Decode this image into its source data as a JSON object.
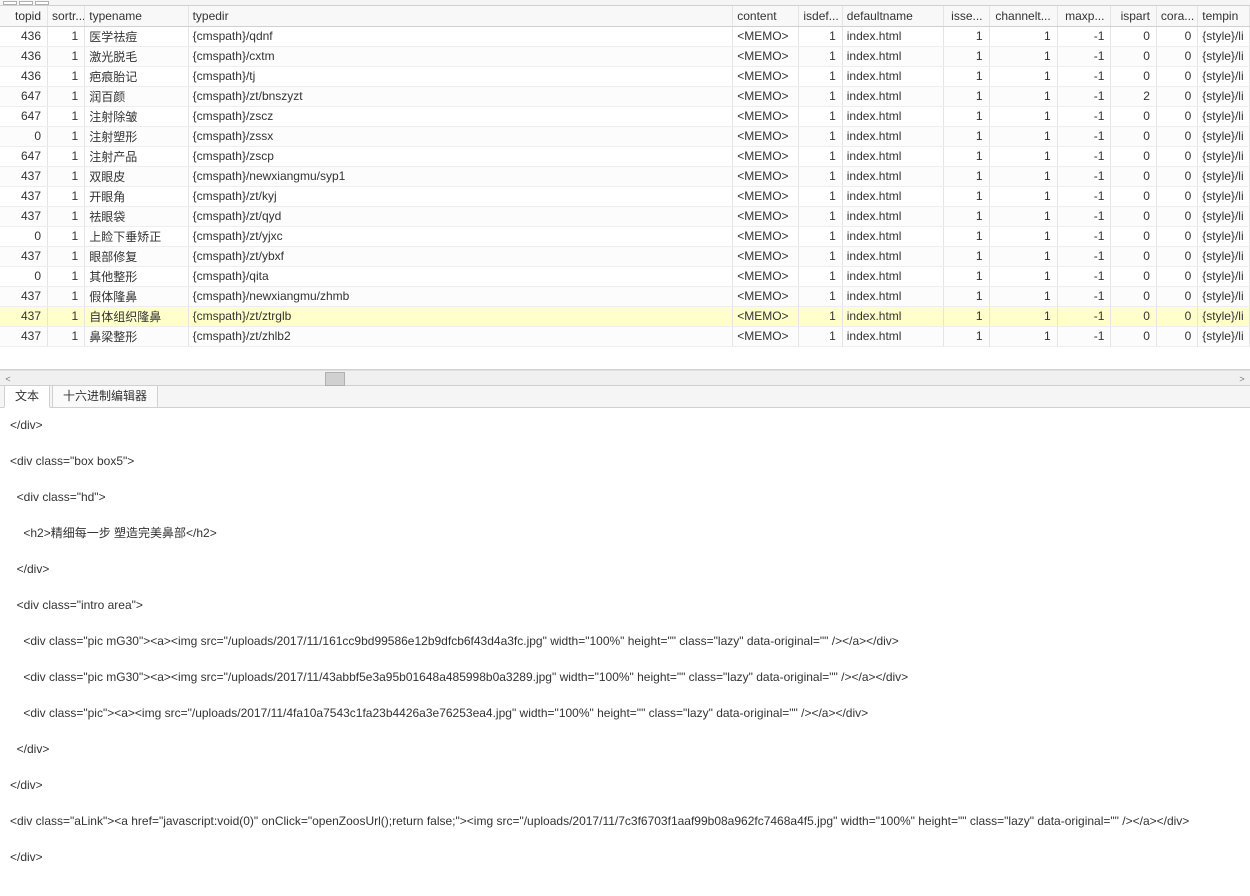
{
  "columns": [
    {
      "key": "topid",
      "label": "topid",
      "cls": "c-topid num"
    },
    {
      "key": "sortr",
      "label": "sortr...",
      "cls": "c-sortr num"
    },
    {
      "key": "typename",
      "label": "typename",
      "cls": "c-typename"
    },
    {
      "key": "typedir",
      "label": "typedir",
      "cls": "c-typedir"
    },
    {
      "key": "content",
      "label": "content",
      "cls": "c-content"
    },
    {
      "key": "isdef",
      "label": "isdef...",
      "cls": "c-isdef num"
    },
    {
      "key": "defaultname",
      "label": "defaultname",
      "cls": "c-defaultname"
    },
    {
      "key": "isse",
      "label": "isse...",
      "cls": "c-isse num"
    },
    {
      "key": "channelt",
      "label": "channelt...",
      "cls": "c-channelt num"
    },
    {
      "key": "maxp",
      "label": "maxp...",
      "cls": "c-maxp num"
    },
    {
      "key": "ispart",
      "label": "ispart",
      "cls": "c-ispart num"
    },
    {
      "key": "cora",
      "label": "cora...",
      "cls": "c-cora num"
    },
    {
      "key": "tempin",
      "label": "tempin",
      "cls": "c-tempin"
    }
  ],
  "rows": [
    {
      "topid": 436,
      "sortr": 1,
      "typename": "医学祛痘",
      "typedir": "{cmspath}/qdnf",
      "content": "<MEMO>",
      "isdef": 1,
      "defaultname": "index.html",
      "isse": 1,
      "channelt": 1,
      "maxp": -1,
      "ispart": 0,
      "cora": 0,
      "tempin": "{style}/li"
    },
    {
      "topid": 436,
      "sortr": 1,
      "typename": "激光脱毛",
      "typedir": "{cmspath}/cxtm",
      "content": "<MEMO>",
      "isdef": 1,
      "defaultname": "index.html",
      "isse": 1,
      "channelt": 1,
      "maxp": -1,
      "ispart": 0,
      "cora": 0,
      "tempin": "{style}/li"
    },
    {
      "topid": 436,
      "sortr": 1,
      "typename": "疤痕胎记",
      "typedir": "{cmspath}/tj",
      "content": "<MEMO>",
      "isdef": 1,
      "defaultname": "index.html",
      "isse": 1,
      "channelt": 1,
      "maxp": -1,
      "ispart": 0,
      "cora": 0,
      "tempin": "{style}/li"
    },
    {
      "topid": 647,
      "sortr": 1,
      "typename": "润百颜",
      "typedir": "{cmspath}/zt/bnszyzt",
      "content": "<MEMO>",
      "isdef": 1,
      "defaultname": "index.html",
      "isse": 1,
      "channelt": 1,
      "maxp": -1,
      "ispart": 2,
      "cora": 0,
      "tempin": "{style}/li"
    },
    {
      "topid": 647,
      "sortr": 1,
      "typename": "注射除皱",
      "typedir": "{cmspath}/zscz",
      "content": "<MEMO>",
      "isdef": 1,
      "defaultname": "index.html",
      "isse": 1,
      "channelt": 1,
      "maxp": -1,
      "ispart": 0,
      "cora": 0,
      "tempin": "{style}/li"
    },
    {
      "topid": 0,
      "sortr": 1,
      "typename": "注射塑形",
      "typedir": "{cmspath}/zssx",
      "content": "<MEMO>",
      "isdef": 1,
      "defaultname": "index.html",
      "isse": 1,
      "channelt": 1,
      "maxp": -1,
      "ispart": 0,
      "cora": 0,
      "tempin": "{style}/li"
    },
    {
      "topid": 647,
      "sortr": 1,
      "typename": "注射产品",
      "typedir": "{cmspath}/zscp",
      "content": "<MEMO>",
      "isdef": 1,
      "defaultname": "index.html",
      "isse": 1,
      "channelt": 1,
      "maxp": -1,
      "ispart": 0,
      "cora": 0,
      "tempin": "{style}/li"
    },
    {
      "topid": 437,
      "sortr": 1,
      "typename": "双眼皮",
      "typedir": "{cmspath}/newxiangmu/syp1",
      "content": "<MEMO>",
      "isdef": 1,
      "defaultname": "index.html",
      "isse": 1,
      "channelt": 1,
      "maxp": -1,
      "ispart": 0,
      "cora": 0,
      "tempin": "{style}/li"
    },
    {
      "topid": 437,
      "sortr": 1,
      "typename": "开眼角",
      "typedir": "{cmspath}/zt/kyj",
      "content": "<MEMO>",
      "isdef": 1,
      "defaultname": "index.html",
      "isse": 1,
      "channelt": 1,
      "maxp": -1,
      "ispart": 0,
      "cora": 0,
      "tempin": "{style}/li"
    },
    {
      "topid": 437,
      "sortr": 1,
      "typename": "祛眼袋",
      "typedir": "{cmspath}/zt/qyd",
      "content": "<MEMO>",
      "isdef": 1,
      "defaultname": "index.html",
      "isse": 1,
      "channelt": 1,
      "maxp": -1,
      "ispart": 0,
      "cora": 0,
      "tempin": "{style}/li"
    },
    {
      "topid": 0,
      "sortr": 1,
      "typename": "上睑下垂矫正",
      "typedir": "{cmspath}/zt/yjxc",
      "content": "<MEMO>",
      "isdef": 1,
      "defaultname": "index.html",
      "isse": 1,
      "channelt": 1,
      "maxp": -1,
      "ispart": 0,
      "cora": 0,
      "tempin": "{style}/li"
    },
    {
      "topid": 437,
      "sortr": 1,
      "typename": "眼部修复",
      "typedir": "{cmspath}/zt/ybxf",
      "content": "<MEMO>",
      "isdef": 1,
      "defaultname": "index.html",
      "isse": 1,
      "channelt": 1,
      "maxp": -1,
      "ispart": 0,
      "cora": 0,
      "tempin": "{style}/li"
    },
    {
      "topid": 0,
      "sortr": 1,
      "typename": "其他整形",
      "typedir": "{cmspath}/qita",
      "content": "<MEMO>",
      "isdef": 1,
      "defaultname": "index.html",
      "isse": 1,
      "channelt": 1,
      "maxp": -1,
      "ispart": 0,
      "cora": 0,
      "tempin": "{style}/li"
    },
    {
      "topid": 437,
      "sortr": 1,
      "typename": "假体隆鼻",
      "typedir": "{cmspath}/newxiangmu/zhmb",
      "content": "<MEMO>",
      "isdef": 1,
      "defaultname": "index.html",
      "isse": 1,
      "channelt": 1,
      "maxp": -1,
      "ispart": 0,
      "cora": 0,
      "tempin": "{style}/li"
    },
    {
      "topid": 437,
      "sortr": 1,
      "typename": "自体组织隆鼻",
      "typedir": "{cmspath}/zt/ztrglb",
      "content": "<MEMO>",
      "isdef": 1,
      "defaultname": "index.html",
      "isse": 1,
      "channelt": 1,
      "maxp": -1,
      "ispart": 0,
      "cora": 0,
      "tempin": "{style}/li",
      "sel": true
    },
    {
      "topid": 437,
      "sortr": 1,
      "typename": "鼻梁整形",
      "typedir": "{cmspath}/zt/zhlb2",
      "content": "<MEMO>",
      "isdef": 1,
      "defaultname": "index.html",
      "isse": 1,
      "channelt": 1,
      "maxp": -1,
      "ispart": 0,
      "cora": 0,
      "tempin": "{style}/li"
    }
  ],
  "tabs": {
    "text": "文本",
    "hex": "十六进制编辑器"
  },
  "editor_content": "</div>\n\n<div class=\"box box5\">\n\n  <div class=\"hd\">\n\n    <h2>精细每一步 塑造完美鼻部</h2>\n\n  </div>\n\n  <div class=\"intro area\">\n\n    <div class=\"pic mG30\"><a><img src=\"/uploads/2017/11/161cc9bd99586e12b9dfcb6f43d4a3fc.jpg\" width=\"100%\" height=\"\" class=\"lazy\" data-original=\"\" /></a></div>\n\n    <div class=\"pic mG30\"><a><img src=\"/uploads/2017/11/43abbf5e3a95b01648a485998b0a3289.jpg\" width=\"100%\" height=\"\" class=\"lazy\" data-original=\"\" /></a></div>\n\n    <div class=\"pic\"><a><img src=\"/uploads/2017/11/4fa10a7543c1fa23b4426a3e76253ea4.jpg\" width=\"100%\" height=\"\" class=\"lazy\" data-original=\"\" /></a></div>\n\n  </div>\n\n</div>\n\n<div class=\"aLink\"><a href=\"javascript:void(0)\" onClick=\"openZoosUrl();return false;\"><img src=\"/uploads/2017/11/7c3f6703f1aaf99b08a962fc7468a4f5.jpg\" width=\"100%\" height=\"\" class=\"lazy\" data-original=\"\" /></a></div>\n\n</div>",
  "scroll": {
    "left_arrow": "<",
    "right_arrow": ">"
  }
}
